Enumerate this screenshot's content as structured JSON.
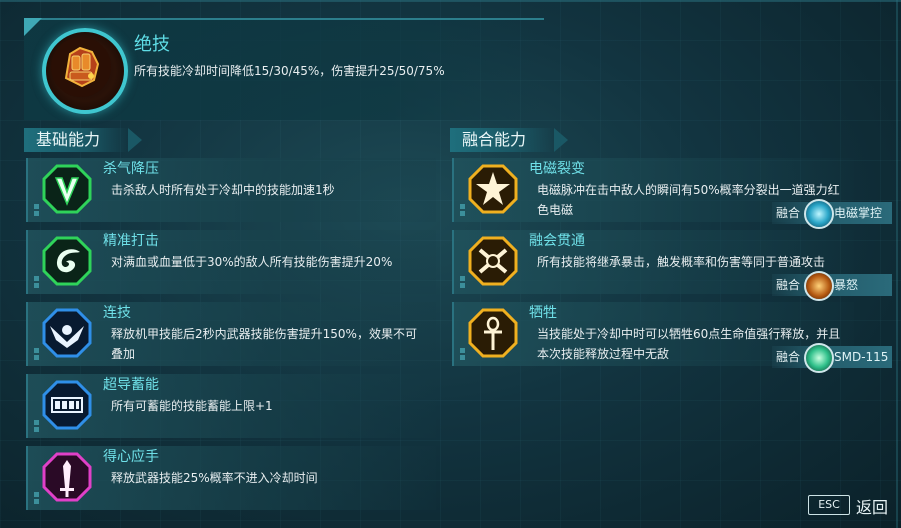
{
  "ultimate": {
    "title": "绝技",
    "description": "所有技能冷却时间降低15/30/45%，伤害提升25/50/75%",
    "icon": "armored-fist-icon"
  },
  "sections": {
    "basic_title": "基础能力",
    "fusion_title": "融合能力"
  },
  "basic_abilities": [
    {
      "name": "杀气降压",
      "description": "击杀敌人时所有处于冷却中的技能加速1秒",
      "icon": "blade-chevron-icon",
      "color": "#2fd35a"
    },
    {
      "name": "精准打击",
      "description": "对满血或血量低于30%的敌人所有技能伤害提升20%",
      "icon": "swirl-icon",
      "color": "#2fd35a"
    },
    {
      "name": "连技",
      "description": "释放机甲技能后2秒内武器技能伤害提升150%，效果不可叠加",
      "icon": "winged-emblem-icon",
      "color": "#2f8fe8"
    },
    {
      "name": "超导蓄能",
      "description": "所有可蓄能的技能蓄能上限+1",
      "icon": "battery-icon",
      "color": "#2f8fe8"
    },
    {
      "name": "得心应手",
      "description": "释放武器技能25%概率不进入冷却时间",
      "icon": "sword-icon",
      "color": "#e040c8"
    }
  ],
  "fusion_abilities": [
    {
      "name": "电磁裂变",
      "description": "电磁脉冲在击中敌人的瞬间有50%概率分裂出一道强力红色电磁",
      "icon": "starburst-icon",
      "color": "#f0b020",
      "fusion_label": "融合",
      "fusion_with": "电磁掌控",
      "fusion_icon": "electro-orb-icon"
    },
    {
      "name": "融会贯通",
      "description": "所有技能将继承暴击，触发概率和伤害等同于普通攻击",
      "icon": "crossed-blades-icon",
      "color": "#f0b020",
      "fusion_label": "融合",
      "fusion_with": "暴怒",
      "fusion_icon": "rage-mech-icon"
    },
    {
      "name": "牺牲",
      "description": "当技能处于冷却中时可以牺牲60点生命值强行释放，并且本次技能释放过程中无敌",
      "icon": "ankh-icon",
      "color": "#f0b020",
      "fusion_label": "融合",
      "fusion_with": "SMD-115",
      "fusion_icon": "drone-icon"
    }
  ],
  "footer": {
    "esc_label": "ESC",
    "back_label": "返回"
  }
}
